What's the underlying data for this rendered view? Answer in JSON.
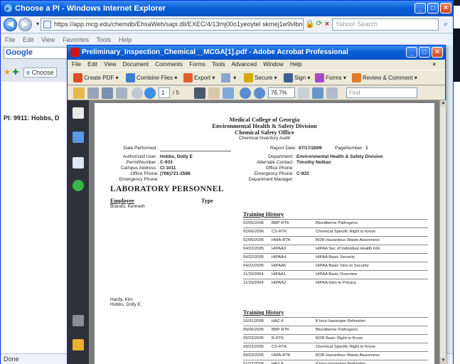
{
  "ie": {
    "title": "Choose a PI - Windows Internet Explorer",
    "address": "https://app.mcg.edu/chemdb/EhsaWeb/sapi.dll/EXEC/4/13mj00o1yeoytel skmej1w9vlbn",
    "search_placeholder": "Yahoo! Search",
    "menu": [
      "File",
      "Edit",
      "View",
      "Favorites",
      "Tools",
      "Help"
    ],
    "google_label": "Google",
    "tab_label": "Choose",
    "pi_text": "PI: 9911: Hobbs, D",
    "status": "Done"
  },
  "acrobat": {
    "title": "Preliminary_Inspection_Chemical__MCGA[1].pdf - Adobe Acrobat Professional",
    "menu": [
      "File",
      "Edit",
      "View",
      "Document",
      "Comments",
      "Forms",
      "Tools",
      "Advanced",
      "Window",
      "Help"
    ],
    "toolbar": {
      "create_pdf": "Create PDF",
      "combine_files": "Combine Files",
      "export": "Export",
      "secure": "Secure",
      "sign": "Sign",
      "forms": "Forms",
      "review_comment": "Review & Comment"
    },
    "page_number": "1",
    "page_total": "/ 5",
    "zoom": "76.7%",
    "find_placeholder": "Find"
  },
  "doc": {
    "header": [
      "Medical College of Georgia",
      "Environmental Health & Safety Division",
      "Chemical Safety Office"
    ],
    "subheader": "Chemical Inventory Audit",
    "date_performed_label": "Date Performed :",
    "report_date_label": "Report Date:",
    "report_date": "07/17/2009",
    "page_number_label": "PageNumber:",
    "page_number": "1",
    "authorized_user_label": "Authorized User :",
    "authorized_user": "Hobbs, Dolly E",
    "department_label": "Department:",
    "department": "Environmental Health & Safety Division",
    "permit_number_label": "PermitNumber :",
    "permit_number": "C-933",
    "alternate_contact_label": "Alternate Contact:",
    "alternate_contact": "Timothy Nolkan",
    "campus_address_label": "Campus Address :",
    "campus_address": "CI 1011",
    "office_phone_label": "Office Phone:",
    "office_phone_label_2": "Office Phone:",
    "office_phone": "(706)721-2598",
    "emergency_phone_label": "Emergency Phone:",
    "emergency_phone_label_2": "Emergency Phone:",
    "emergency_phone_2": "C-933",
    "department_manager_label": "Department Manager:",
    "section_title": "LABORATORY PERSONNEL",
    "employee_header": "Employee",
    "type_header": "Type",
    "employees": [
      "Brandu, Kenneth",
      "Hardy, Kim",
      "Hobbs, Dolly E"
    ],
    "training_history_label": "Training History",
    "training_1": [
      [
        "02/06/2006",
        "BBP-RTK",
        "Bloodborne Pathogens"
      ],
      [
        "02/06/2006",
        "CS-RTK",
        "Chemical Specific Right to Know"
      ],
      [
        "02/06/2006",
        "HWA-RTK",
        "BOR Hazardous Waste Awareness"
      ],
      [
        "04/22/2005",
        "HIPAA3",
        "HIPAA Sec of Individual Health Info"
      ],
      [
        "04/22/2005",
        "HIPAA4",
        "HIPAA Basic Security"
      ],
      [
        "04/22/2005",
        "HIPAA5",
        "HIPAA Basic Intro to Security"
      ],
      [
        "11/29/2004",
        "HIPAA1",
        "HIPAA Basic Overview"
      ],
      [
        "11/29/2004",
        "HIPAA2",
        "HIPAA Intro to Privacy"
      ]
    ],
    "training_2": [
      [
        "10/31/2005",
        "HAZ 8",
        "8 hour hazwoper Refresher"
      ],
      [
        "09/26/2005",
        "BBP-RTK",
        "Bloodborne Pathogens"
      ],
      [
        "09/23/2005",
        "B-RTK",
        "BOR Basic Right to Know"
      ],
      [
        "09/22/2005",
        "CS-RTK",
        "Chemical Specific Right to Know"
      ],
      [
        "09/23/2005",
        "HWA-RTK",
        "BOR Hazardous Waste Awareness"
      ],
      [
        "01/22/2004",
        "HAZ 8",
        "8 hour hazwoper Refresher"
      ]
    ]
  },
  "colors": {
    "xp_title": "#0a5fd6",
    "acro_nav": "#2e3238",
    "doc_bg": "#7d7d7d"
  }
}
